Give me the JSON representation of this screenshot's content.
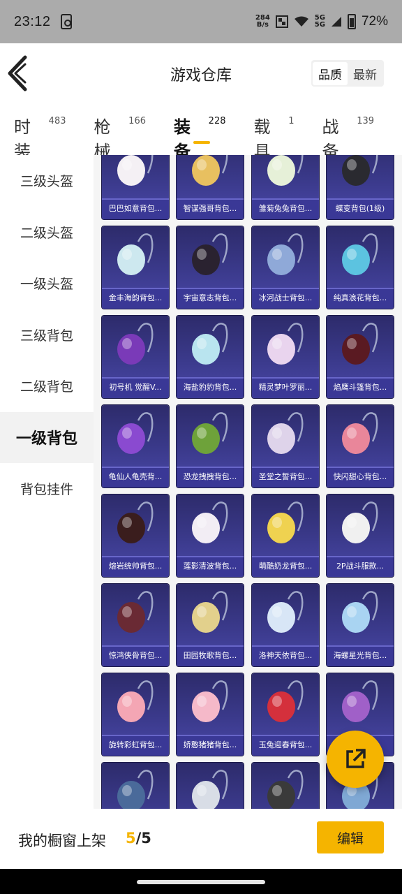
{
  "status_bar": {
    "time": "23:12",
    "speed_value": "284",
    "speed_unit": "B/s",
    "net_top": "5G",
    "net_bottom": "5G",
    "battery": "72%"
  },
  "header": {
    "title": "游戏仓库",
    "sort_quality": "品质",
    "sort_latest": "最新"
  },
  "tabs": [
    {
      "label": "时装",
      "count": "483",
      "active": false
    },
    {
      "label": "枪械",
      "count": "166",
      "active": false
    },
    {
      "label": "装备",
      "count": "228",
      "active": true
    },
    {
      "label": "载具",
      "count": "1",
      "active": false
    },
    {
      "label": "战备",
      "count": "139",
      "active": false
    }
  ],
  "sidebar": [
    {
      "label": "三级头盔",
      "active": false
    },
    {
      "label": "二级头盔",
      "active": false
    },
    {
      "label": "一级头盔",
      "active": false
    },
    {
      "label": "三级背包",
      "active": false
    },
    {
      "label": "二级背包",
      "active": false
    },
    {
      "label": "一级背包",
      "active": true
    },
    {
      "label": "背包挂件",
      "active": false
    }
  ],
  "items": [
    {
      "name": "巴巴如意背包...",
      "color": "#f4f0f4"
    },
    {
      "name": "智谋强哥背包...",
      "color": "#e8c060"
    },
    {
      "name": "雏菊兔兔背包...",
      "color": "#e6f0d8"
    },
    {
      "name": "蝶变背包(1级)",
      "color": "#2a2a30"
    },
    {
      "name": "金丰海韵背包...",
      "color": "#cde8ef"
    },
    {
      "name": "宇宙意志背包...",
      "color": "#2a2230"
    },
    {
      "name": "冰河战士背包...",
      "color": "#8fa9d8"
    },
    {
      "name": "纯真浪花背包...",
      "color": "#5cc3e0"
    },
    {
      "name": "初号机 觉醒V...",
      "color": "#7a3ab8"
    },
    {
      "name": "海盐豹豹背包...",
      "color": "#b9e4ef"
    },
    {
      "name": "精灵梦叶罗丽...",
      "color": "#e9d4ee"
    },
    {
      "name": "焰鹰斗篷背包...",
      "color": "#5a1a22"
    },
    {
      "name": "龟仙人龟壳背...",
      "color": "#8a4ad0"
    },
    {
      "name": "恐龙拽拽背包...",
      "color": "#6ea23a"
    },
    {
      "name": "圣堂之誓背包...",
      "color": "#ded3ea"
    },
    {
      "name": "快闪甜心背包...",
      "color": "#e9869a"
    },
    {
      "name": "熔岩统帅背包...",
      "color": "#3a1d1d"
    },
    {
      "name": "莲影清波背包...",
      "color": "#f2edf4"
    },
    {
      "name": "萌酷奶龙背包...",
      "color": "#efd250"
    },
    {
      "name": "2P战斗服款...",
      "color": "#f0f0f0"
    },
    {
      "name": "惊鸿侠骨背包...",
      "color": "#6a2a34"
    },
    {
      "name": "田园牧歌背包...",
      "color": "#e2d08c"
    },
    {
      "name": "洛神天依背包...",
      "color": "#d8e6f6"
    },
    {
      "name": "海螺星光背包...",
      "color": "#a9d4f2"
    },
    {
      "name": "旋转彩虹背包...",
      "color": "#f4a6b4"
    },
    {
      "name": "娇憨猪猪背包...",
      "color": "#f5b9c9"
    },
    {
      "name": "玉兔迎春背包...",
      "color": "#d4303c"
    },
    {
      "name": "",
      "color": "#a060c8"
    },
    {
      "name": "",
      "color": "#4a6a9a"
    },
    {
      "name": "",
      "color": "#d8dde6"
    },
    {
      "name": "",
      "color": "#3a3a3a"
    },
    {
      "name": "",
      "color": "#7fa8d4"
    }
  ],
  "footer": {
    "text": "我的橱窗上架",
    "current": "5",
    "separator": "/",
    "total": "5",
    "edit_label": "编辑"
  },
  "colors": {
    "accent": "#f5b400",
    "card_bg": "#3b3a8c"
  },
  "icons": {
    "back": "chevron-left-icon",
    "fab": "share-external-icon"
  }
}
